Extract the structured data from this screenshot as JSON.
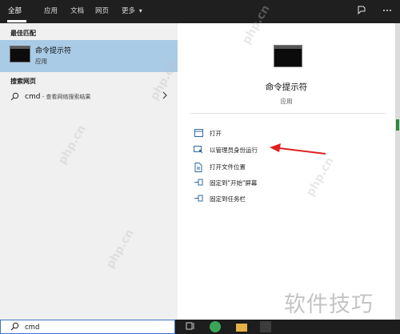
{
  "tabs": [
    {
      "label": "全部",
      "active": true
    },
    {
      "label": "应用"
    },
    {
      "label": "文档"
    },
    {
      "label": "网页"
    },
    {
      "label": "更多",
      "has_dropdown": true
    }
  ],
  "more_dropdown_glyph": "▾",
  "top_icons": [
    "feedback-icon",
    "more-options-icon"
  ],
  "left": {
    "best_match_header": "最佳匹配",
    "best_match": {
      "title": "命令提示符",
      "subtitle": "应用"
    },
    "web_header": "搜索网页",
    "web_result": {
      "query": "cmd",
      "hint": " - 查看网络搜索结果"
    }
  },
  "right": {
    "title": "命令提示符",
    "subtitle": "应用",
    "actions": [
      {
        "label": "打开",
        "icon": "open-icon"
      },
      {
        "label": "以管理员身份运行",
        "icon": "run-as-admin-icon"
      },
      {
        "label": "打开文件位置",
        "icon": "file-location-icon"
      },
      {
        "label": "固定到\"开始\"屏幕",
        "icon": "pin-start-icon"
      },
      {
        "label": "固定到任务栏",
        "icon": "pin-taskbar-icon"
      }
    ]
  },
  "watermark": {
    "site": "php.cn",
    "brand": "软件技巧"
  },
  "taskbar": {
    "search_value": "cmd",
    "icons": [
      "task-view-icon",
      "green-app-icon",
      "file-explorer-icon",
      "app-icon"
    ]
  },
  "colors": {
    "top_bar": "#1f1f1f",
    "selected_result": "#a9cbe6",
    "accent_arrow": "#e02020",
    "taskbar": "#1d1d1d"
  }
}
